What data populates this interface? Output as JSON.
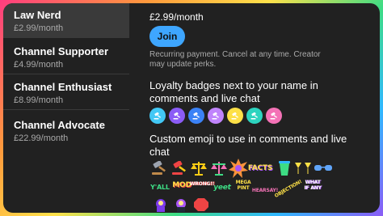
{
  "tiers": [
    {
      "name": "Law Nerd",
      "price": "£2.99/month",
      "selected": true
    },
    {
      "name": "Channel Supporter",
      "price": "£4.99/month",
      "selected": false
    },
    {
      "name": "Channel Enthusiast",
      "price": "£8.99/month",
      "selected": false
    },
    {
      "name": "Channel Advocate",
      "price": "£22.99/month",
      "selected": false
    }
  ],
  "detail": {
    "price": "£2.99/month",
    "join_label": "Join",
    "recurring_note": "Recurring payment. Cancel at any time. Creator may update perks.",
    "badges_title": "Loyalty badges next to your name in comments and live chat",
    "emoji_title": "Custom emoji to use in comments and live chat"
  },
  "badge_colors": [
    "#42c8f5",
    "#8b5cf6",
    "#3b82f6",
    "#c084fc",
    "#fde047",
    "#2dd4bf",
    "#f472b6"
  ],
  "emoji": {
    "facts": "FACTS",
    "yall": "Y'ALL",
    "mod": "MOD",
    "wrong": "WRONG!!",
    "yeet": "yeet",
    "mega_pint": "MEGA PINT",
    "hearsay": "HEARSAY!",
    "objection": "OBJECTION!",
    "what_if": "WHAT IF ANY"
  }
}
